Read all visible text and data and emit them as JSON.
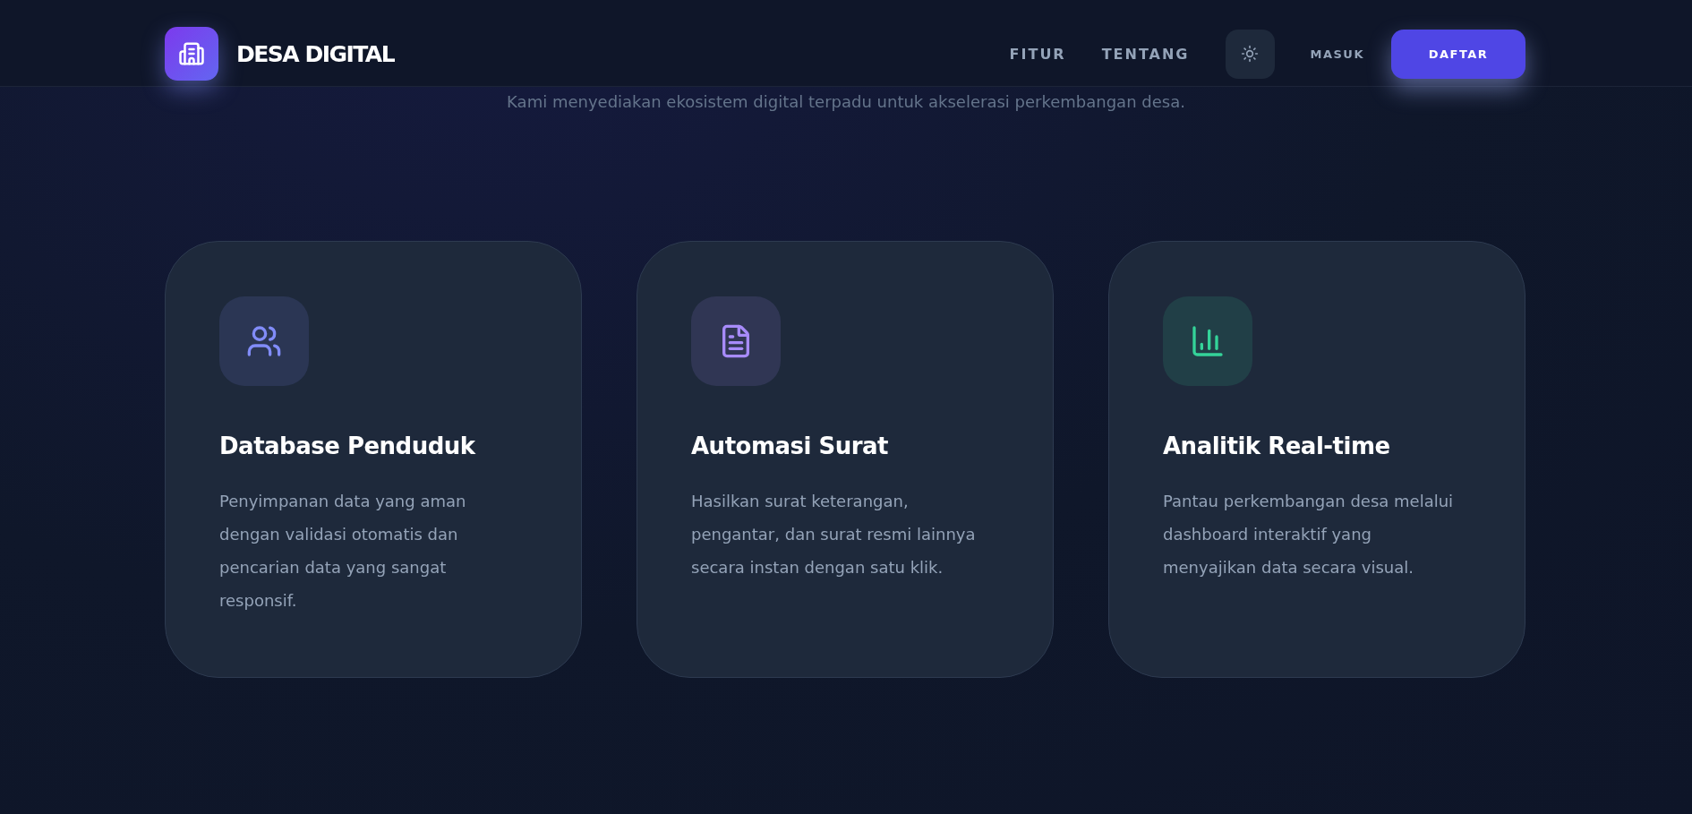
{
  "header": {
    "brand": "DESA DIGITAL",
    "nav": [
      "FITUR",
      "TENTANG"
    ],
    "login": "MASUK",
    "register": "DAFTAR"
  },
  "subtitle": "Kami menyediakan ekosistem digital terpadu untuk akselerasi perkembangan desa.",
  "features": [
    {
      "kind": "people",
      "color": "#818cf8",
      "title": "Database Penduduk",
      "text": "Penyimpanan data yang aman dengan validasi otomatis dan pencarian data yang sangat responsif."
    },
    {
      "kind": "document",
      "color": "#a78bfa",
      "title": "Automasi Surat",
      "text": "Hasilkan surat keterangan, pengantar, dan surat resmi lainnya secara instan dengan satu klik."
    },
    {
      "kind": "chart",
      "color": "#34d399",
      "title": "Analitik Real-time",
      "text": "Pantau perkembangan desa melalui dashboard interaktif yang menyajikan data secara visual."
    }
  ]
}
